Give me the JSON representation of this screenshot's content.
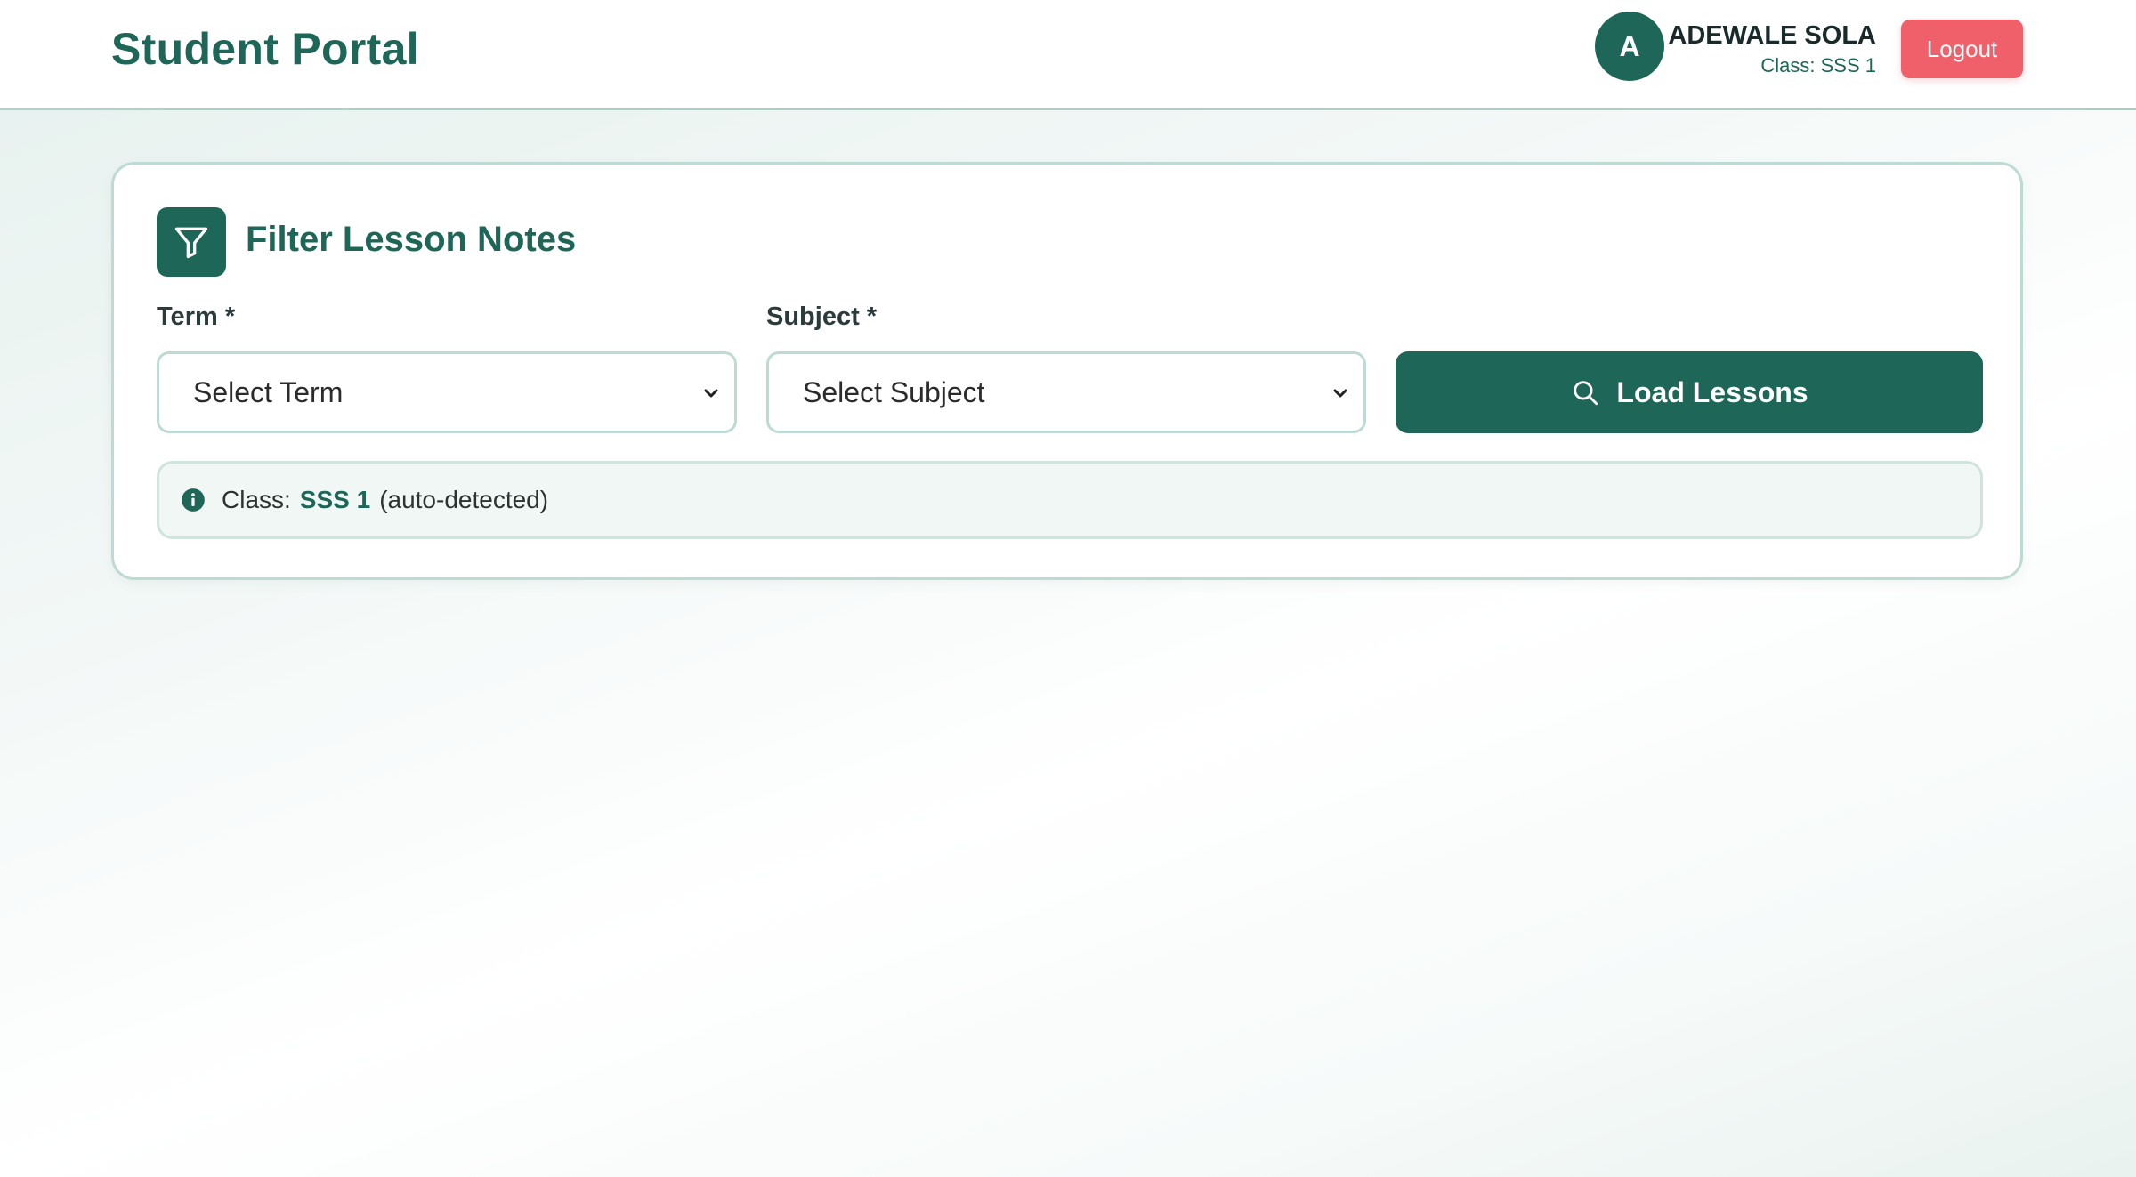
{
  "header": {
    "brand": "Student Portal",
    "avatar_initial": "A",
    "user_name": "ADEWALE SOLA",
    "user_class": "Class: SSS 1",
    "logout_label": "Logout"
  },
  "filter_card": {
    "title": "Filter Lesson Notes",
    "term_label": "Term *",
    "term_value": "Select Term",
    "subject_label": "Subject *",
    "subject_value": "Select Subject",
    "load_button_label": "Load Lessons",
    "info": {
      "prefix": "Class:",
      "class_value": "SSS 1",
      "suffix": "(auto-detected)"
    }
  },
  "colors": {
    "brand": "#1e6657",
    "logout": "#f0606a",
    "border": "#bddbd4"
  },
  "icons": {
    "filter": "filter-icon",
    "search": "search-icon",
    "info": "info-icon",
    "chevron": "chevron-down-icon"
  }
}
